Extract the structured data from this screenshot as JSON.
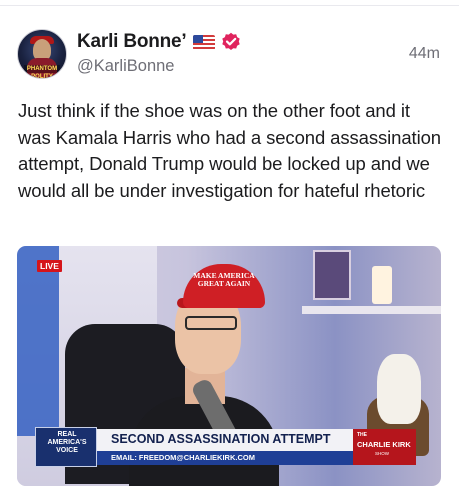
{
  "post": {
    "author_name": "Karli Bonne’",
    "author_handle": "@KarliBonne",
    "timestamp": "44m",
    "flag_icon": "us-flag-icon",
    "verified_icon": "verified-badge-icon",
    "verified_color": "#e0245e",
    "avatar_caption": "PHANTOM POLITY",
    "text": "Just think if the shoe was on the other foot and it was Kamala Harris who had a second assassination attempt, Donald Trump would be locked up and we would all be under investigation for hateful rhetoric"
  },
  "media": {
    "live_label": "LIVE",
    "cap_text": "MAKE AMERICA GREAT AGAIN",
    "network_logo": "REAL AMERICA'S VOICE",
    "headline": "SECOND ASSASSINATION ATTEMPT",
    "subline": "EMAIL: FREEDOM@CHARLIEKIRK.COM",
    "show_small": "THE",
    "show_name": "CHARLIE KIRK",
    "show_sub": "SHOW",
    "accent_red": "#d5141a",
    "accent_blue": "#1f3f96"
  }
}
